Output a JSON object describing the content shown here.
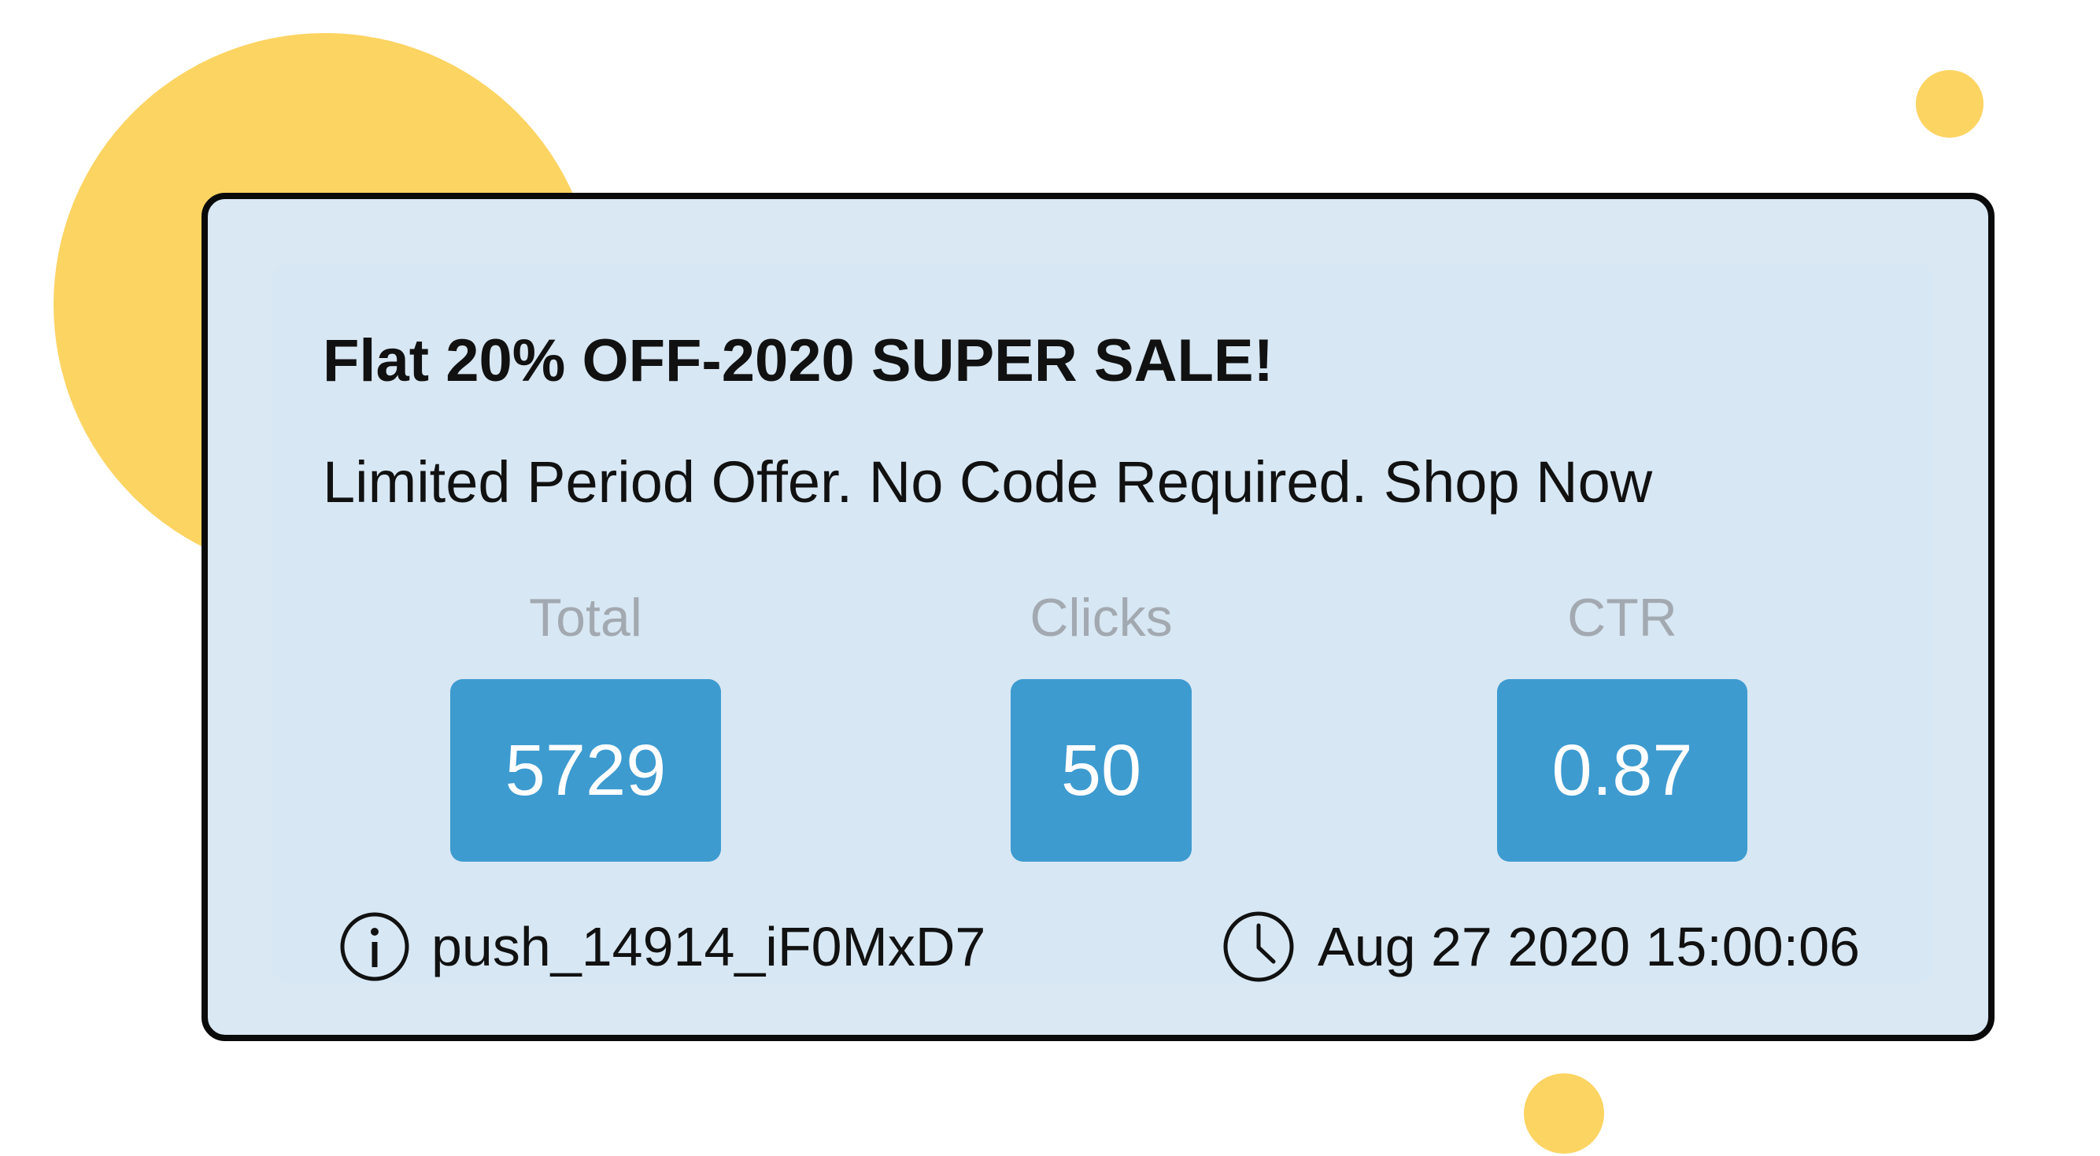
{
  "notification": {
    "title": "Flat 20% OFF-2020 SUPER SALE!",
    "message": "Limited Period Offer. No Code Required. Shop Now"
  },
  "stats": [
    {
      "label": "Total",
      "value": "5729"
    },
    {
      "label": "Clicks",
      "value": "50"
    },
    {
      "label": "CTR",
      "value": "0.87"
    }
  ],
  "footer": {
    "campaign_id": "push_14914_iF0MxD7",
    "timestamp": "Aug 27 2020 15:00:06",
    "info_icon": "info-icon",
    "clock_icon": "clock-icon"
  },
  "colors": {
    "card_background": "#D9E8F3",
    "stat_badge": "#3D9BD0",
    "decoration": "#FCD462",
    "label_gray": "#A3A9B0"
  }
}
